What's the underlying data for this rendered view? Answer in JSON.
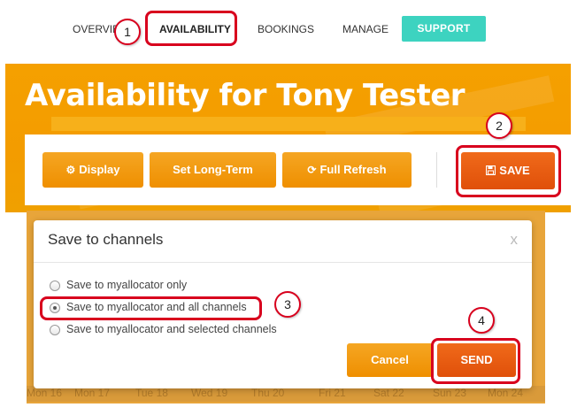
{
  "nav": {
    "tabs": [
      {
        "label": "OVERVIEW"
      },
      {
        "label": "AVAILABILITY"
      },
      {
        "label": "BOOKINGS"
      },
      {
        "label": "MANAGE"
      },
      {
        "label": "SUPPORT"
      }
    ],
    "active": "AVAILABILITY",
    "support_color": "#3dd3c0"
  },
  "page": {
    "title": "Availability for Tony Tester"
  },
  "toolbar": {
    "display_label": "Display",
    "display_icon": "gear-icon",
    "longterm_label": "Set Long-Term",
    "refresh_label": "Full Refresh",
    "refresh_icon": "refresh-icon",
    "save_label": "SAVE",
    "save_icon": "floppy-disk-icon"
  },
  "modal": {
    "title": "Save to channels",
    "close_label": "x",
    "options": [
      {
        "label": "Save to myallocator only",
        "checked": false
      },
      {
        "label": "Save to myallocator and all channels",
        "checked": true
      },
      {
        "label": "Save to myallocator and selected channels",
        "checked": false
      }
    ],
    "cancel_label": "Cancel",
    "send_label": "SEND"
  },
  "calendar": {
    "days": [
      "Mon 16",
      "Mon 17",
      "Tue 18",
      "Wed 19",
      "Thu 20",
      "Fri 21",
      "Sat 22",
      "Sun 23",
      "Mon 24"
    ]
  },
  "callouts": [
    "1",
    "2",
    "3",
    "4"
  ],
  "colors": {
    "accent_orange": "#ef8f00",
    "save_orange": "#e0500a",
    "highlight_red": "#d8001d",
    "banner": "#f39c00"
  }
}
